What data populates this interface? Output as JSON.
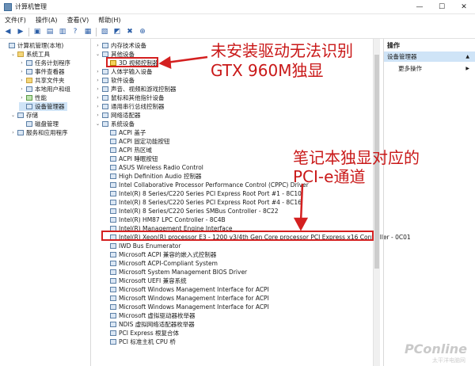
{
  "window": {
    "title": "计算机管理",
    "controls": [
      "—",
      "☐",
      "✕"
    ]
  },
  "menu": [
    "文件(F)",
    "操作(A)",
    "查看(V)",
    "帮助(H)"
  ],
  "toolbar": [
    "◀",
    "▶",
    "▣",
    "▤",
    "▥",
    "?",
    "▦",
    "▧",
    "◩",
    "✖",
    "⊕"
  ],
  "left_tree": [
    {
      "label": "计算机管理(本地)",
      "indent": 0,
      "exp": "",
      "icon": "computer"
    },
    {
      "label": "系统工具",
      "indent": 1,
      "exp": "▼",
      "icon": "tools"
    },
    {
      "label": "任务计划程序",
      "indent": 2,
      "exp": "›",
      "icon": "clock"
    },
    {
      "label": "事件查看器",
      "indent": 2,
      "exp": "›",
      "icon": "event"
    },
    {
      "label": "共享文件夹",
      "indent": 2,
      "exp": "›",
      "icon": "folder"
    },
    {
      "label": "本地用户和组",
      "indent": 2,
      "exp": "›",
      "icon": "users"
    },
    {
      "label": "性能",
      "indent": 2,
      "exp": "›",
      "icon": "perf"
    },
    {
      "label": "设备管理器",
      "indent": 2,
      "exp": "",
      "icon": "device",
      "selected": true
    },
    {
      "label": "存储",
      "indent": 1,
      "exp": "▼",
      "icon": "storage"
    },
    {
      "label": "磁盘管理",
      "indent": 2,
      "exp": "",
      "icon": "disk"
    },
    {
      "label": "服务和应用程序",
      "indent": 1,
      "exp": "›",
      "icon": "services"
    }
  ],
  "device_tree": [
    {
      "label": "内存技术设备",
      "indent": 0,
      "exp": "›",
      "icon": "plain"
    },
    {
      "label": "其他设备",
      "indent": 0,
      "exp": "▼",
      "icon": "plain"
    },
    {
      "label": "3D 视频控制器",
      "indent": 1,
      "exp": "",
      "icon": "warn"
    },
    {
      "label": "人体学输入设备",
      "indent": 0,
      "exp": "›",
      "icon": "plain"
    },
    {
      "label": "软件设备",
      "indent": 0,
      "exp": "›",
      "icon": "plain"
    },
    {
      "label": "声音、视频和游戏控制器",
      "indent": 0,
      "exp": "›",
      "icon": "plain"
    },
    {
      "label": "鼠标和其他指针设备",
      "indent": 0,
      "exp": "›",
      "icon": "plain"
    },
    {
      "label": "通用串行总线控制器",
      "indent": 0,
      "exp": "›",
      "icon": "plain"
    },
    {
      "label": "网络适配器",
      "indent": 0,
      "exp": "›",
      "icon": "plain"
    },
    {
      "label": "系统设备",
      "indent": 0,
      "exp": "▼",
      "icon": "plain"
    },
    {
      "label": "ACPI 盖子",
      "indent": 1,
      "exp": "",
      "icon": "plain"
    },
    {
      "label": "ACPI 固定功能按钮",
      "indent": 1,
      "exp": "",
      "icon": "plain"
    },
    {
      "label": "ACPI 热区域",
      "indent": 1,
      "exp": "",
      "icon": "plain"
    },
    {
      "label": "ACPI 睡眠按钮",
      "indent": 1,
      "exp": "",
      "icon": "plain"
    },
    {
      "label": "ASUS Wireless Radio Control",
      "indent": 1,
      "exp": "",
      "icon": "plain"
    },
    {
      "label": "High Definition Audio 控制器",
      "indent": 1,
      "exp": "",
      "icon": "plain"
    },
    {
      "label": "Intel Collaborative Processor Performance Control (CPPC) Driver",
      "indent": 1,
      "exp": "",
      "icon": "plain"
    },
    {
      "label": "Intel(R) 8 Series/C220 Series PCI Express Root Port #1 - 8C10",
      "indent": 1,
      "exp": "",
      "icon": "plain"
    },
    {
      "label": "Intel(R) 8 Series/C220 Series PCI Express Root Port #4 - 8C16",
      "indent": 1,
      "exp": "",
      "icon": "plain"
    },
    {
      "label": "Intel(R) 8 Series/C220 Series SMBus Controller - 8C22",
      "indent": 1,
      "exp": "",
      "icon": "plain"
    },
    {
      "label": "Intel(R) HM87 LPC Controller - 8C4B",
      "indent": 1,
      "exp": "",
      "icon": "plain"
    },
    {
      "label": "Intel(R) Management Engine Interface",
      "indent": 1,
      "exp": "",
      "icon": "plain"
    },
    {
      "label": "Intel(R) Xeon(R) processor E3 - 1200 v3/4th Gen Core processor PCI Express x16 Controller - 0C01",
      "indent": 1,
      "exp": "",
      "icon": "plain"
    },
    {
      "label": "IWD Bus Enumerator",
      "indent": 1,
      "exp": "",
      "icon": "plain"
    },
    {
      "label": "Microsoft ACPI 兼容的嵌入式控制器",
      "indent": 1,
      "exp": "",
      "icon": "plain"
    },
    {
      "label": "Microsoft ACPI-Compliant System",
      "indent": 1,
      "exp": "",
      "icon": "plain"
    },
    {
      "label": "Microsoft System Management BIOS Driver",
      "indent": 1,
      "exp": "",
      "icon": "plain"
    },
    {
      "label": "Microsoft UEFI 兼容系统",
      "indent": 1,
      "exp": "",
      "icon": "plain"
    },
    {
      "label": "Microsoft Windows Management Interface for ACPI",
      "indent": 1,
      "exp": "",
      "icon": "plain"
    },
    {
      "label": "Microsoft Windows Management Interface for ACPI",
      "indent": 1,
      "exp": "",
      "icon": "plain"
    },
    {
      "label": "Microsoft Windows Management Interface for ACPI",
      "indent": 1,
      "exp": "",
      "icon": "plain"
    },
    {
      "label": "Microsoft 虚拟驱动器枚举器",
      "indent": 1,
      "exp": "",
      "icon": "plain"
    },
    {
      "label": "NDIS 虚拟网络适配器枚举器",
      "indent": 1,
      "exp": "",
      "icon": "plain"
    },
    {
      "label": "PCI Express 根复合体",
      "indent": 1,
      "exp": "",
      "icon": "plain"
    },
    {
      "label": "PCI 标准主机 CPU 桥",
      "indent": 1,
      "exp": "",
      "icon": "plain"
    }
  ],
  "right_pane": {
    "header": "操作",
    "selected": "设备管理器",
    "more": "更多操作"
  },
  "annotations": {
    "top_line1": "未安装驱动无法识别",
    "top_line2": "GTX 960M独显",
    "mid_line1": "笔记本独显对应的",
    "mid_line2": "PCI-e通道",
    "color": "#c91818"
  },
  "watermark": {
    "brand": "PConline",
    "sub": "太平洋电脑网"
  }
}
